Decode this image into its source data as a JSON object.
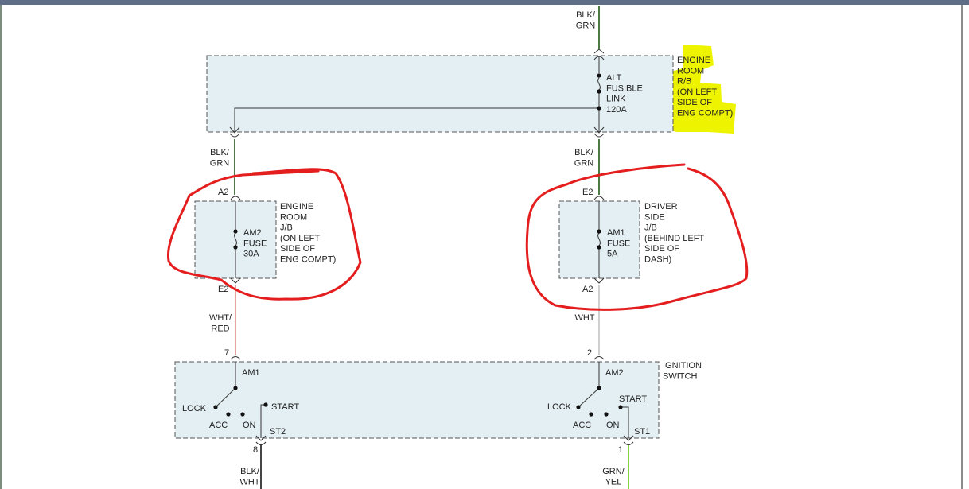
{
  "colors": {
    "box_fill": "#e4eff4",
    "box_border": "#555555",
    "wire_blk_grn": "#4b7a43",
    "wire_wht_red": "#e9a0a0",
    "wire_wht": "#cfcfcf",
    "wire_grn_yel": "#86d23c",
    "wire_blk_wht": "#444444",
    "highlight_yellow": "#eef300",
    "annotation_red": "#e41e1e"
  },
  "wires": {
    "top": "BLK/\nGRN",
    "left_upper": "BLK/\nGRN",
    "right_upper": "BLK/\nGRN",
    "left_lower": "WHT/\nRED",
    "right_lower": "WHT",
    "bottom_left": "BLK/\nWHT",
    "bottom_right": "GRN/\nYEL"
  },
  "engine_room_rb": {
    "label": "ENGINE\nROOM\nR/B\n(ON LEFT\nSIDE OF\nENG COMPT)",
    "fuse": "ALT\nFUSIBLE\nLINK\n120A"
  },
  "engine_room_jb": {
    "label": "ENGINE\nROOM\nJ/B\n(ON LEFT\nSIDE OF\nENG COMPT)",
    "fuse": "AM2\nFUSE\n30A",
    "pin_in": "A2",
    "pin_out": "E2"
  },
  "driver_side_jb": {
    "label": "DRIVER\nSIDE\nJ/B\n(BEHIND LEFT\nSIDE OF\nDASH)",
    "fuse": "AM1\nFUSE\n5A",
    "pin_in": "E2",
    "pin_out": "A2"
  },
  "ignition_switch": {
    "label": "IGNITION\nSWITCH",
    "left_pin_in": "7",
    "right_pin_in": "2",
    "left_pin_out": "8",
    "right_pin_out": "1",
    "left_input": "AM1",
    "right_input": "AM2",
    "left_output": "ST2",
    "right_output": "ST1",
    "positions": {
      "lock": "LOCK",
      "acc": "ACC",
      "on": "ON",
      "start": "START"
    }
  }
}
